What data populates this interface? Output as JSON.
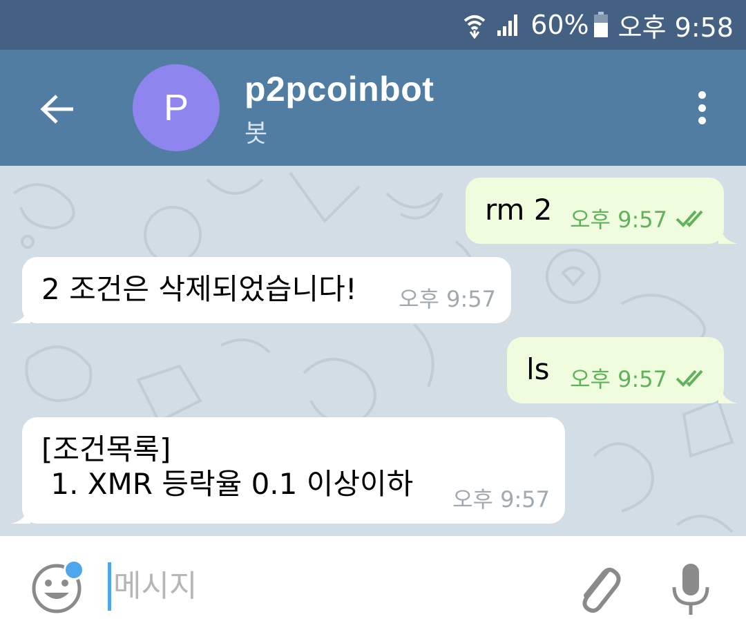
{
  "status_bar": {
    "battery": "60%",
    "time": "오후 9:58",
    "icons": [
      "wifi-icon",
      "signal-icon",
      "battery-icon"
    ]
  },
  "header": {
    "avatar_letter": "P",
    "title": "p2pcoinbot",
    "subtitle": "봇",
    "icons": [
      "back-arrow-icon",
      "more-vert-icon"
    ]
  },
  "messages": [
    {
      "direction": "out",
      "text": "rm 2",
      "time": "오후 9:57",
      "read": true
    },
    {
      "direction": "in",
      "text": "2 조건은 삭제되었습니다!",
      "time": "오후 9:57"
    },
    {
      "direction": "out",
      "text": "ls",
      "time": "오후 9:57",
      "read": true
    },
    {
      "direction": "in",
      "text": "[조건목록]\n 1. XMR 등락율 0.1 이상이하",
      "time": "오후 9:57"
    }
  ],
  "composer": {
    "placeholder": "메시지",
    "icons": [
      "emoji-icon",
      "attach-icon",
      "mic-icon"
    ]
  },
  "colors": {
    "status_bar": "#446184",
    "app_bar": "#527da3",
    "avatar": "#8e85ee",
    "outgoing_bubble": "#effdde",
    "incoming_bubble": "#ffffff",
    "check_marks": "#5fb25a",
    "accent": "#4ea7ec"
  }
}
